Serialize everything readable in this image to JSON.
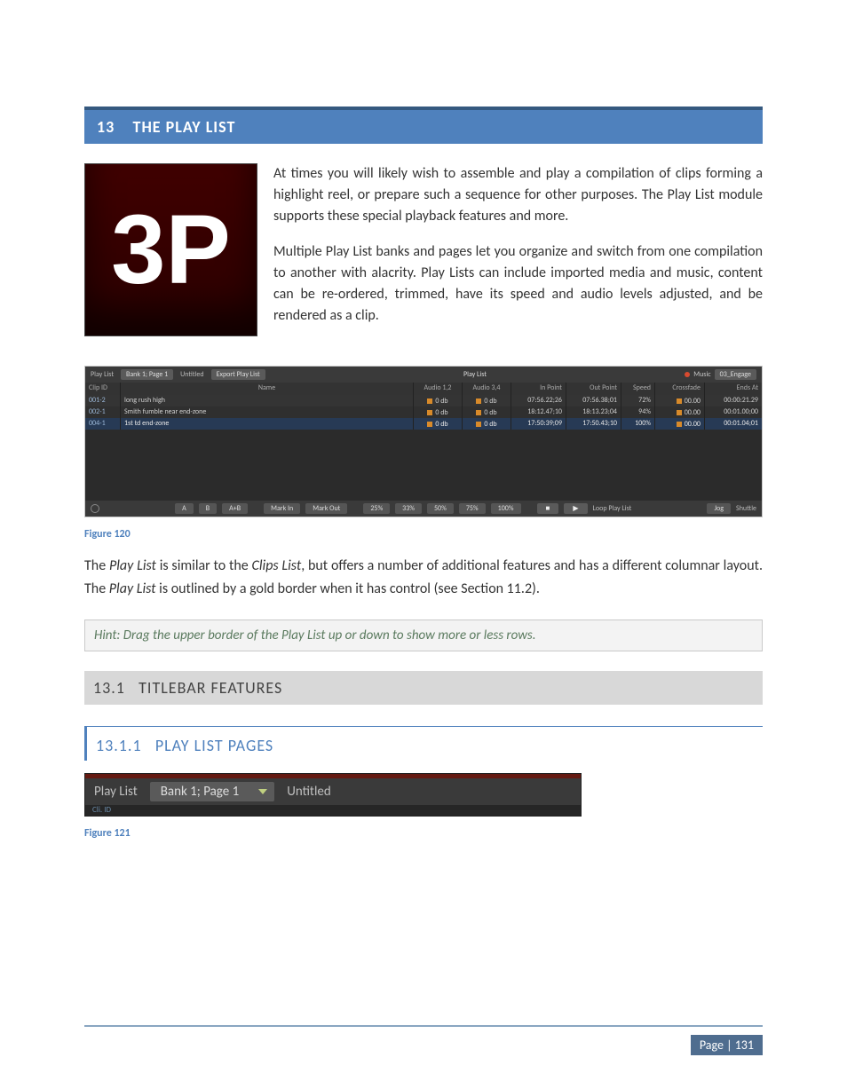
{
  "section": {
    "number": "13",
    "title": "THE PLAY LIST"
  },
  "logo": "3P",
  "intro": {
    "p1": "At times you will likely wish to assemble and play a compilation of clips forming a highlight reel, or prepare such a sequence for other purposes. The Play List module supports these special playback features and more.",
    "p2": "Multiple Play List banks and pages let you organize and switch from one compilation to another with alacrity. Play Lists can include imported media and music, content can be re-ordered, trimmed, have its speed and audio levels adjusted, and be rendered as a clip."
  },
  "playlist": {
    "top": {
      "label": "Play List",
      "bank": "Bank 1; Page 1",
      "name": "Untitled",
      "export": "Export Play List",
      "center": "Play List",
      "music_lbl": "Music",
      "music_file": "03_Engage"
    },
    "headers": {
      "id": "Clip ID",
      "name": "Name",
      "a12": "Audio 1,2",
      "a34": "Audio 3,4",
      "in": "In Point",
      "out": "Out Point",
      "spd": "Speed",
      "xf": "Crossfade",
      "end": "Ends At"
    },
    "rows": [
      {
        "id": "001-2",
        "name": "long rush high",
        "a12": "0 db",
        "a34": "0 db",
        "in": "07:56.22;26",
        "out": "07:56.38;01",
        "spd": "72%",
        "xf": "00.00",
        "end": "00:00:21.29",
        "sel": false
      },
      {
        "id": "002-1",
        "name": "Smith fumble near end-zone",
        "a12": "0 db",
        "a34": "0 db",
        "in": "18:12.47;10",
        "out": "18:13.23;04",
        "spd": "94%",
        "xf": "00.00",
        "end": "00:01.00;00",
        "sel": false
      },
      {
        "id": "004-1",
        "name": "1st td end-zone",
        "a12": "0 db",
        "a34": "0 db",
        "in": "17:50:39;09",
        "out": "17:50.43;10",
        "spd": "100%",
        "xf": "00.00",
        "end": "00:01.04;01",
        "sel": true
      }
    ],
    "bottom": {
      "btnA": "A",
      "btnB": "B",
      "btnAB": "A+B",
      "markIn": "Mark In",
      "markOut": "Mark Out",
      "p25": "25%",
      "p33": "33%",
      "p50": "50%",
      "p75": "75%",
      "p100": "100%",
      "stop": "■",
      "play": "▶",
      "loop": "Loop Play List",
      "jog": "Jog",
      "shuttle": "Shuttle"
    }
  },
  "figure120": "Figure 120",
  "body_para_pre": "The ",
  "body_para_em1": "Play List",
  "body_para_mid1": " is similar to the ",
  "body_para_em2": "Clips List",
  "body_para_mid2": ", but offers a number of additional features and has a different columnar layout. The ",
  "body_para_em3": "Play List",
  "body_para_post": " is outlined by a gold border when it has control (see Section 11.2).",
  "hint": "Hint: Drag the upper border of the Play List up or down to show more or less rows.",
  "sub": {
    "num": "13.1",
    "title": "TITLEBAR FEATURES"
  },
  "subsub": {
    "num": "13.1.1",
    "title": "PLAY LIST PAGES"
  },
  "small": {
    "label": "Play List",
    "bank": "Bank 1; Page 1",
    "name": "Untitled",
    "row3": "Cli.  ID"
  },
  "figure121": "Figure 121",
  "footer": "Page | 131"
}
